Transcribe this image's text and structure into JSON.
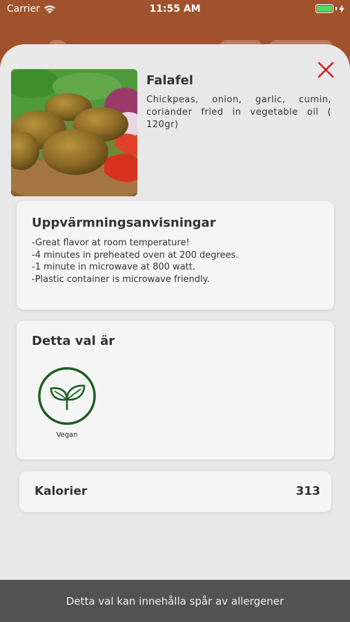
{
  "status_bar": {
    "carrier": "Carrier",
    "time": "11:55 AM"
  },
  "product": {
    "name": "Falafel",
    "description": "Chickpeas, onion, garlic, cumin, coriander fried in vegetable oil ( 120gr)"
  },
  "heating": {
    "title": "Uppvärmningsanvisningar",
    "lines": [
      "-Great flavor at room temperature!",
      "-4 minutes in preheated oven at 200 degrees.",
      "-1 minute in microwave at 800 watt.",
      "-Plastic container is microwave friendly."
    ]
  },
  "diet": {
    "title": "Detta val är",
    "badges": [
      {
        "label": "Vegan",
        "icon": "leaf-sprout-icon",
        "color": "#1b5e20"
      }
    ]
  },
  "calories": {
    "label": "Kalorier",
    "value": "313"
  },
  "footer": {
    "text": "Detta val kan innehålla spår av allergener"
  },
  "colors": {
    "header_bg": "#a0522d",
    "sheet_bg": "#e9e8e8",
    "close_icon": "#cc1f1f",
    "footer_bg": "#525252",
    "battery": "#4cd964"
  }
}
